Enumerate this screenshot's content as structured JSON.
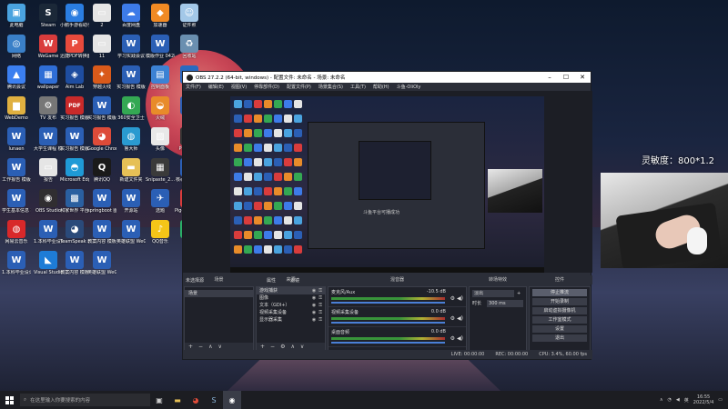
{
  "desktop": {
    "icons": [
      {
        "label": "此电脑",
        "color": "#4aa3df",
        "glyph": "▣"
      },
      {
        "label": "Steam",
        "color": "#1b2838",
        "glyph": "S"
      },
      {
        "label": "小鹅手游看助手",
        "color": "#2a7de1",
        "glyph": "◉"
      },
      {
        "label": "2",
        "color": "#e5e5e5",
        "glyph": "▭"
      },
      {
        "label": "百度网盘",
        "color": "#3d7be8",
        "glyph": "☁"
      },
      {
        "label": "加速器",
        "color": "#f08a24",
        "glyph": "◆"
      },
      {
        "label": "证件照",
        "color": "#a3c8e8",
        "glyph": "☺"
      },
      {
        "label": "网络",
        "color": "#3a80c8",
        "glyph": "◎"
      },
      {
        "label": "WeGame",
        "color": "#d93c3c",
        "glyph": "W"
      },
      {
        "label": "迅捷PDF转换器",
        "color": "#e84a3c",
        "glyph": "P"
      },
      {
        "label": "11",
        "color": "#e5e5e5",
        "glyph": "▭"
      },
      {
        "label": "学习实践会议",
        "color": "#2b5fb5",
        "glyph": "W"
      },
      {
        "label": "模版作业 0428",
        "color": "#2b5fb5",
        "glyph": "W"
      },
      {
        "label": "回收站",
        "color": "#6a8fb0",
        "glyph": "♻"
      },
      {
        "label": "腾讯会议",
        "color": "#3b7ff0",
        "glyph": "▲"
      },
      {
        "label": "wallpaper",
        "color": "#2f6ed6",
        "glyph": "▦"
      },
      {
        "label": "Aim Lab",
        "color": "#1e4da0",
        "glyph": "◈"
      },
      {
        "label": "穿越火线",
        "color": "#d95a1a",
        "glyph": "✦"
      },
      {
        "label": "实习报告 模版",
        "color": "#2b5fb5",
        "glyph": "W"
      },
      {
        "label": "控制面板",
        "color": "#3c82d4",
        "glyph": "▤"
      },
      {
        "label": "KTKT",
        "color": "#2a6ac0",
        "glyph": "K"
      },
      {
        "label": "WebDemo",
        "color": "#e0b040",
        "glyph": "▆"
      },
      {
        "label": "TV 发布",
        "color": "#777",
        "glyph": "⚙"
      },
      {
        "label": "实习报告 模版",
        "color": "#c82a2a",
        "glyph": "PDF"
      },
      {
        "label": "实习报告 模版",
        "color": "#2b5fb5",
        "glyph": "W"
      },
      {
        "label": "360安全卫士",
        "color": "#34a853",
        "glyph": "◐"
      },
      {
        "label": "火绒",
        "color": "#e88b2a",
        "glyph": "◒"
      },
      {
        "label": "作业",
        "color": "#2b5fb5",
        "glyph": "W"
      },
      {
        "label": "lunaen",
        "color": "#2b5fb5",
        "glyph": "W"
      },
      {
        "label": "大学生课程 模版",
        "color": "#2b5fb5",
        "glyph": "W"
      },
      {
        "label": "实习报告 模版",
        "color": "#2b5fb5",
        "glyph": "W"
      },
      {
        "label": "Google Chrome",
        "color": "#dd4b39",
        "glyph": "◕"
      },
      {
        "label": "鲁大师",
        "color": "#2a9ad0",
        "glyph": "◍"
      },
      {
        "label": "头像",
        "color": "#e8e8e8",
        "glyph": "▨"
      },
      {
        "label": "Phasmop",
        "color": "#333",
        "glyph": "▥"
      },
      {
        "label": "工作报告 模版",
        "color": "#2b5fb5",
        "glyph": "W"
      },
      {
        "label": "报告",
        "color": "#e5e5e5",
        "glyph": "▭"
      },
      {
        "label": "Microsoft Edge",
        "color": "#1f9ad6",
        "glyph": "◓"
      },
      {
        "label": "腾讯QQ",
        "color": "#1a1a1a",
        "glyph": "Q"
      },
      {
        "label": "新建文件夹",
        "color": "#e6c056",
        "glyph": "▬"
      },
      {
        "label": "Snipaste_2...",
        "color": "#3a3a3a",
        "glyph": "▦"
      },
      {
        "label": "核心课程规划",
        "color": "#2b5fb5",
        "glyph": "W"
      },
      {
        "label": "学生基本信息 模板",
        "color": "#2b5fb5",
        "glyph": "W"
      },
      {
        "label": "OBS Studio",
        "color": "#302e31",
        "glyph": "◉"
      },
      {
        "label": "和家世界 平台",
        "color": "#2a5fa0",
        "glyph": "▩"
      },
      {
        "label": "springboot 图书管理",
        "color": "#2b5fb5",
        "glyph": "W"
      },
      {
        "label": "开源站",
        "color": "#2b5fb5",
        "glyph": "W"
      },
      {
        "label": "选题",
        "color": "#2b5fb5",
        "glyph": "✈"
      },
      {
        "label": "Pigchat加速器",
        "color": "#d93c3c",
        "glyph": "P"
      },
      {
        "label": "网易云音乐",
        "color": "#d8282a",
        "glyph": "◍"
      },
      {
        "label": "1.本科毕业设计",
        "color": "#2b5fb5",
        "glyph": "W"
      },
      {
        "label": "TeamSpeak 3",
        "color": "#2a4a7a",
        "glyph": "◕"
      },
      {
        "label": "教案内容 模板",
        "color": "#2b5fb5",
        "glyph": "W"
      },
      {
        "label": "英雄联盟 WeGame",
        "color": "#2b5fb5",
        "glyph": "W"
      },
      {
        "label": "QQ音乐",
        "color": "#f5c518",
        "glyph": "♪"
      },
      {
        "label": "微信",
        "color": "#2aae67",
        "glyph": "◍"
      },
      {
        "label": "1.本科毕业设计",
        "color": "#2b5fb5",
        "glyph": "W"
      },
      {
        "label": "Visual Studio Code",
        "color": "#1e7cd6",
        "glyph": "◣"
      },
      {
        "label": "教案内容 模板",
        "color": "#2b5fb5",
        "glyph": "W"
      },
      {
        "label": "英雄联盟 WeGame",
        "color": "#2b5fb5",
        "glyph": "W"
      }
    ]
  },
  "overlay": {
    "sensitivity": "灵敏度：800*1.2"
  },
  "obs": {
    "title": "OBS 27.2.2 (64-bit, windows) - 配置文件: 未命名 - 场景: 未命名",
    "menu": [
      "文件(F)",
      "编辑(E)",
      "视图(V)",
      "停靠部件(D)",
      "配置文件(P)",
      "场景集合(S)",
      "工具(T)",
      "帮助(H)",
      "斗鱼-OliOly"
    ],
    "preview_caption": "斗鱼平台可播成功",
    "dock_header": "未选择源",
    "dock_header_right": [
      "属性",
      "滤镜"
    ],
    "panels": {
      "scenes": {
        "title": "场景",
        "items": [
          "场景"
        ]
      },
      "sources": {
        "title": "来源",
        "items": [
          "游戏捕获",
          "图像",
          "文本（GDI+）",
          "视频采集设备",
          "显示器采集"
        ]
      },
      "mixer": {
        "title": "混音器",
        "channels": [
          {
            "name": "麦克风/Aux",
            "db": "-10.5 dB"
          },
          {
            "name": "视频采集设备",
            "db": "0.0 dB"
          },
          {
            "name": "桌面音频",
            "db": "0.0 dB"
          }
        ]
      },
      "transitions": {
        "title": "转场特效",
        "type": "淡出",
        "duration_label": "时长",
        "duration": "300 ms"
      },
      "controls": {
        "title": "控件",
        "buttons": [
          "停止推流",
          "开始录制",
          "启动虚拟摄像机",
          "工作室模式",
          "设置",
          "退出"
        ]
      }
    },
    "status": [
      "LIVE: 00:00:00",
      "REC: 00:00:00",
      "CPU: 3.4%, 60.00 fps"
    ]
  },
  "taskbar": {
    "search_placeholder": "在这里输入你要搜索的内容",
    "time": "16:55",
    "date": "2022/5/4",
    "tray_text": "英"
  }
}
